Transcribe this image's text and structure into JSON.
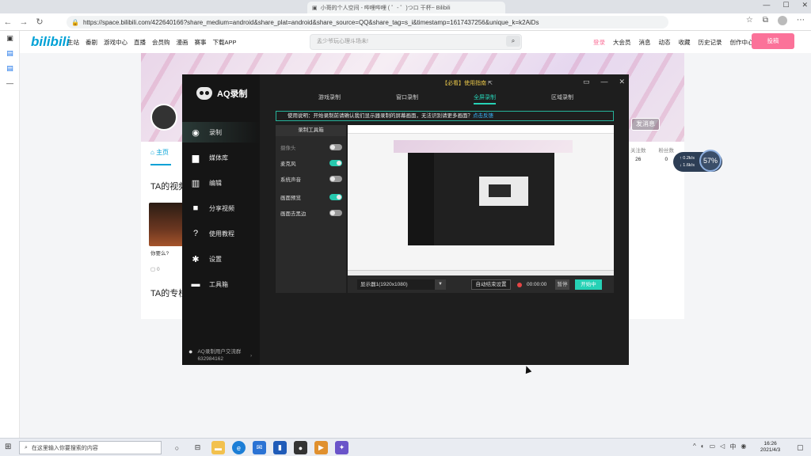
{
  "browser": {
    "tab_title": "小哥的个人空间 - 哔哩哔哩 ( ゜- ゜)つロ 干杯~ Bilibili",
    "url": "https://space.bilibili.com/422640166?share_medium=android&share_plat=android&share_source=QQ&share_tag=s_i&timestamp=1617437256&unique_k=k2AiDs",
    "window_controls": [
      "—",
      "☐",
      "✕"
    ]
  },
  "bili": {
    "logo": "bilibili",
    "nav": [
      "主站",
      "番剧",
      "游戏中心",
      "直播",
      "会员购",
      "漫画",
      "赛事",
      "下载APP"
    ],
    "search_placeholder": "孟少爷玩心理斗场未!",
    "right": [
      "登录",
      "大会员",
      "消息",
      "动态",
      "收藏",
      "历史记录",
      "创作中心"
    ],
    "upload": "投稿"
  },
  "profile": {
    "tab_home": "主页",
    "heading_videos": "TA的视频",
    "heading_columns": "TA的专栏",
    "video_title": "你要么?",
    "video_meta": "0",
    "follow": "发消息",
    "stats": [
      {
        "label": "关注数",
        "value": "26"
      },
      {
        "label": "粉丝数",
        "value": "0"
      }
    ]
  },
  "speed": {
    "up": "0.2k/s",
    "down": "1.6k/s",
    "percent": "57%"
  },
  "aq": {
    "logo": "AQ录制",
    "links": "【必看】使用指南",
    "menu": [
      {
        "label": "录制",
        "icon": "record-icon"
      },
      {
        "label": "媒体库",
        "icon": "folder-icon"
      },
      {
        "label": "编辑",
        "icon": "edit-icon"
      },
      {
        "label": "分享视频",
        "icon": "camera-icon"
      },
      {
        "label": "使用教程",
        "icon": "help-icon"
      },
      {
        "label": "设置",
        "icon": "gear-icon"
      },
      {
        "label": "工具箱",
        "icon": "toolbox-icon"
      }
    ],
    "tabs": [
      "游戏录制",
      "窗口录制",
      "全屏录制",
      "区域录制"
    ],
    "notice": "使用说明：开始录制前请确认我们显示器录制的屏幕画面，无法识别请更多画面？",
    "notice_link": "点击反馈",
    "toolbox_title": "录制工具箱",
    "tools": [
      {
        "label": "摄像头",
        "on": false
      },
      {
        "label": "麦克风",
        "on": true
      },
      {
        "label": "系统声音",
        "on": false
      },
      {
        "label": "画面预览",
        "on": true
      },
      {
        "label": "画面去黑边",
        "on": false
      }
    ],
    "display": "显示器1(1920x1080)",
    "auto": "自动结束设置",
    "time": "00:00:00",
    "pause": "暂停",
    "start": "开始中",
    "footer_line1": "AQ录制用户交流群",
    "footer_line2": "632984162"
  },
  "taskbar": {
    "search": "在这里输入你要搜索的内容",
    "time": "16:26",
    "date": "2021/4/3"
  }
}
